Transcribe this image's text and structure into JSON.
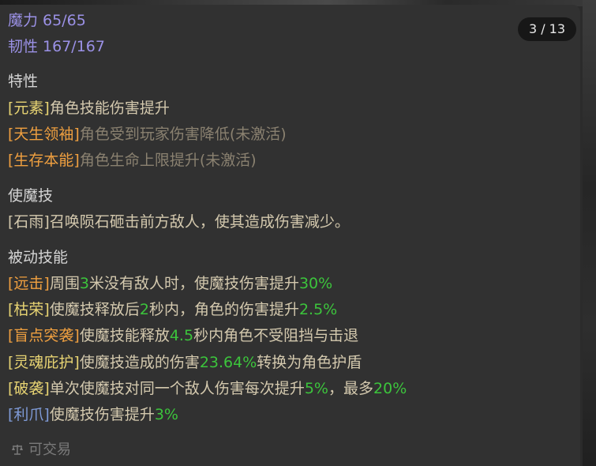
{
  "counter": "3 / 13",
  "stats": {
    "mana": "魔力 65/65",
    "toughness": "韧性 167/167"
  },
  "traits": {
    "heading": "特性",
    "rows": [
      {
        "tag": "[元素]",
        "text": "角色技能伤害提升"
      },
      {
        "tag": "[天生领袖]",
        "text": "角色受到玩家伤害降低(未激活)"
      },
      {
        "tag": "[生存本能]",
        "text": "角色生命上限提升(未激活)"
      }
    ]
  },
  "active": {
    "heading": "使魔技",
    "text": "[石雨]召唤陨石砸击前方敌人，使其造成伤害减少。"
  },
  "passive": {
    "heading": "被动技能",
    "rows": [
      {
        "tag": "[远击]",
        "p1": "周围",
        "n1": "3",
        "p2": "米没有敌人时，使魔技伤害提升",
        "n2": "30%",
        "p3": ""
      },
      {
        "tag": "[枯荣]",
        "p1": "使魔技释放后",
        "n1": "2",
        "p2": "秒内，角色的伤害提升",
        "n2": "2.5%",
        "p3": ""
      },
      {
        "tag": "[盲点突袭]",
        "p1": "使魔技能释放",
        "n1": "4.5",
        "p2": "秒内角色不受阻挡与击退",
        "n2": "",
        "p3": ""
      },
      {
        "tag": "[灵魂庇护]",
        "p1": "使魔技造成的伤害",
        "n1": "23.64%",
        "p2": "转换为角色护盾",
        "n2": "",
        "p3": ""
      },
      {
        "tag": "[破袭]",
        "p1": "单次使魔技对同一个敌人伤害每次提升",
        "n1": "5%",
        "p2": "，最多",
        "n2": "20%",
        "p3": ""
      },
      {
        "tag": "[利爪]",
        "p1": "使魔技伤害提升",
        "n1": "3%",
        "p2": "",
        "n2": "",
        "p3": ""
      }
    ]
  },
  "footer": {
    "icon": "scale-icon",
    "label": "可交易"
  }
}
